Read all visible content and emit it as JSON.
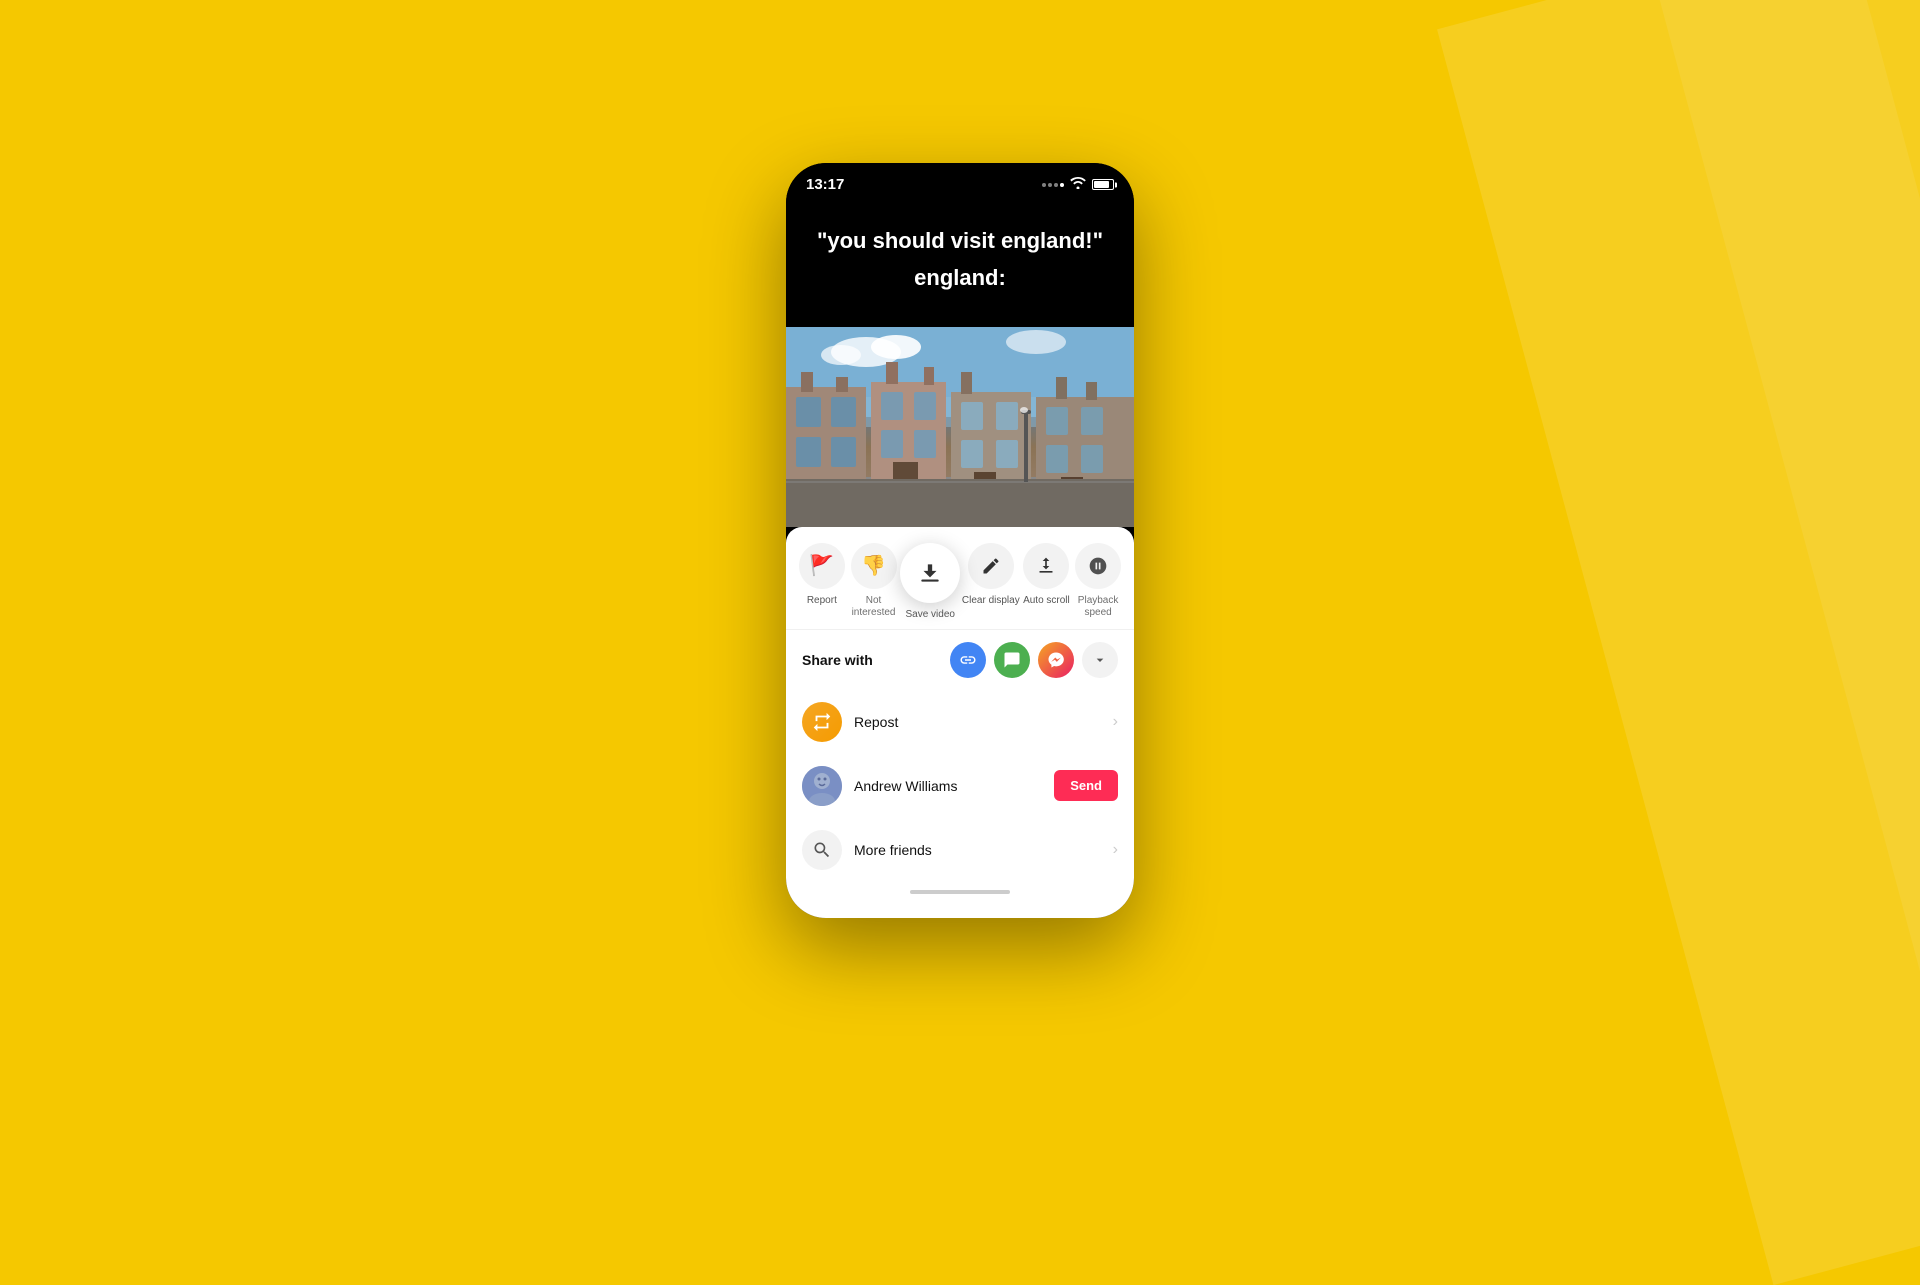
{
  "phone": {
    "status_bar": {
      "time": "13:17",
      "battery_label": "battery"
    },
    "video": {
      "quote": "\"you should visit england!\"",
      "caption": "england:"
    },
    "actions": [
      {
        "id": "report",
        "icon": "🚩",
        "label": "Report"
      },
      {
        "id": "not-interested",
        "icon": "👎",
        "label": "Not interested"
      },
      {
        "id": "save-video",
        "icon": "⬇",
        "label": "Save video",
        "highlighted": true
      },
      {
        "id": "clear-display",
        "icon": "✏",
        "label": "Clear display"
      },
      {
        "id": "auto-scroll",
        "icon": "⬆",
        "label": "Auto scroll"
      },
      {
        "id": "playback-speed",
        "icon": "⏱",
        "label": "Playback speed"
      }
    ],
    "share": {
      "label": "Share with",
      "icons": [
        {
          "id": "link",
          "type": "link",
          "icon": "🔗"
        },
        {
          "id": "message",
          "type": "message",
          "icon": "💬"
        },
        {
          "id": "messenger",
          "type": "messenger",
          "icon": "🅼"
        }
      ],
      "more_label": "chevron-down"
    },
    "list_items": [
      {
        "id": "repost",
        "icon_type": "repost",
        "label": "Repost",
        "has_chevron": true
      },
      {
        "id": "andrew-williams",
        "icon_type": "avatar",
        "label": "Andrew Williams",
        "action": "Send",
        "has_chevron": false
      },
      {
        "id": "more-friends",
        "icon_type": "search",
        "label": "More friends",
        "has_chevron": true
      }
    ],
    "send_button_label": "Send"
  }
}
